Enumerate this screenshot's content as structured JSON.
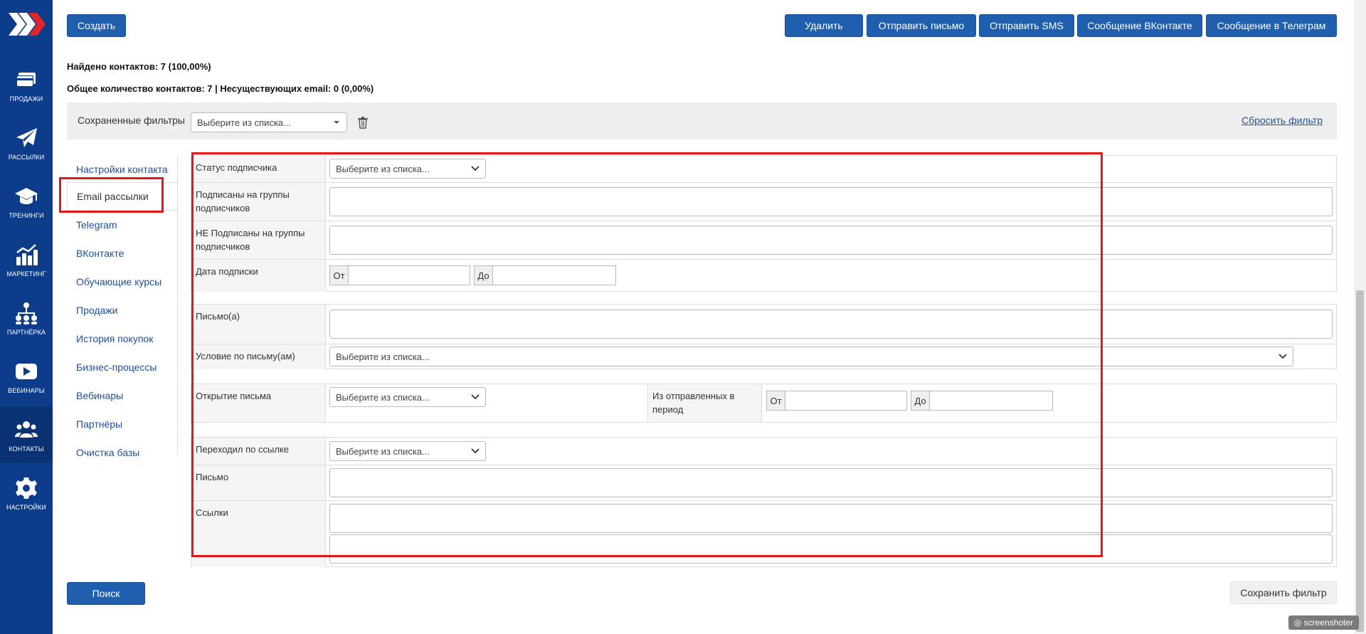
{
  "sidebar": {
    "items": [
      {
        "label": "Продажи",
        "icon": "cart-icon"
      },
      {
        "label": "Рассылки",
        "icon": "paper-plane-icon"
      },
      {
        "label": "Тренинги",
        "icon": "graduation-cap-icon"
      },
      {
        "label": "Маркетинг",
        "icon": "chart-icon"
      },
      {
        "label": "Партнёрка",
        "icon": "network-icon"
      },
      {
        "label": "Вебинары",
        "icon": "play-icon"
      },
      {
        "label": "Контакты",
        "icon": "users-icon"
      },
      {
        "label": "Настройки",
        "icon": "gear-icon"
      }
    ],
    "active": "Контакты"
  },
  "toolbar": {
    "create": "Создать",
    "delete": "Удалить",
    "send_email": "Отправить письмо",
    "send_sms": "Отправить SMS",
    "vk_message": "Сообщение ВКонтакте",
    "telegram_message": "Сообщение в Телеграм"
  },
  "stats": {
    "found": "Найдено контактов: 7 (100,00%)",
    "total": "Общее количество контактов: 7 | Несуществующих email: 0 (0,00%)"
  },
  "saved_filters": {
    "label": "Сохраненные фильтры",
    "placeholder": "Выберите из списка...",
    "reset": "Сбросить фильтр"
  },
  "tabs": [
    "Настройки контакта",
    "Email рассылки",
    "Telegram",
    "ВКонтакте",
    "Обучающие курсы",
    "Продажи",
    "История покупок",
    "Бизнес-процессы",
    "Вебинары",
    "Партнёры",
    "Очистка базы"
  ],
  "active_tab": "Email рассылки",
  "form": {
    "select_placeholder": "Выберите из списка...",
    "from": "От",
    "to": "До",
    "subscriber_status": "Статус подписчика",
    "subscribed_groups": "Подписаны на группы подписчиков",
    "not_subscribed_groups": "НЕ Подписаны на группы подписчиков",
    "subscription_date": "Дата подписки",
    "letters": "Письмо(а)",
    "letter_condition": "Условие по письму(ам)",
    "letter_open": "Открытие письма",
    "sent_in_period": "Из отправленных в период",
    "clicked_link": "Переходил по ссылке",
    "letter": "Письмо",
    "links": "Ссылки"
  },
  "bottom": {
    "search": "Поиск",
    "save_filter": "Сохранить фильтр"
  },
  "watermark": "screenshoter",
  "colors": {
    "sidebar": "#0d3d8a",
    "primary_button": "#1f5fae",
    "highlight": "#e01818",
    "link": "#1f4f96"
  }
}
